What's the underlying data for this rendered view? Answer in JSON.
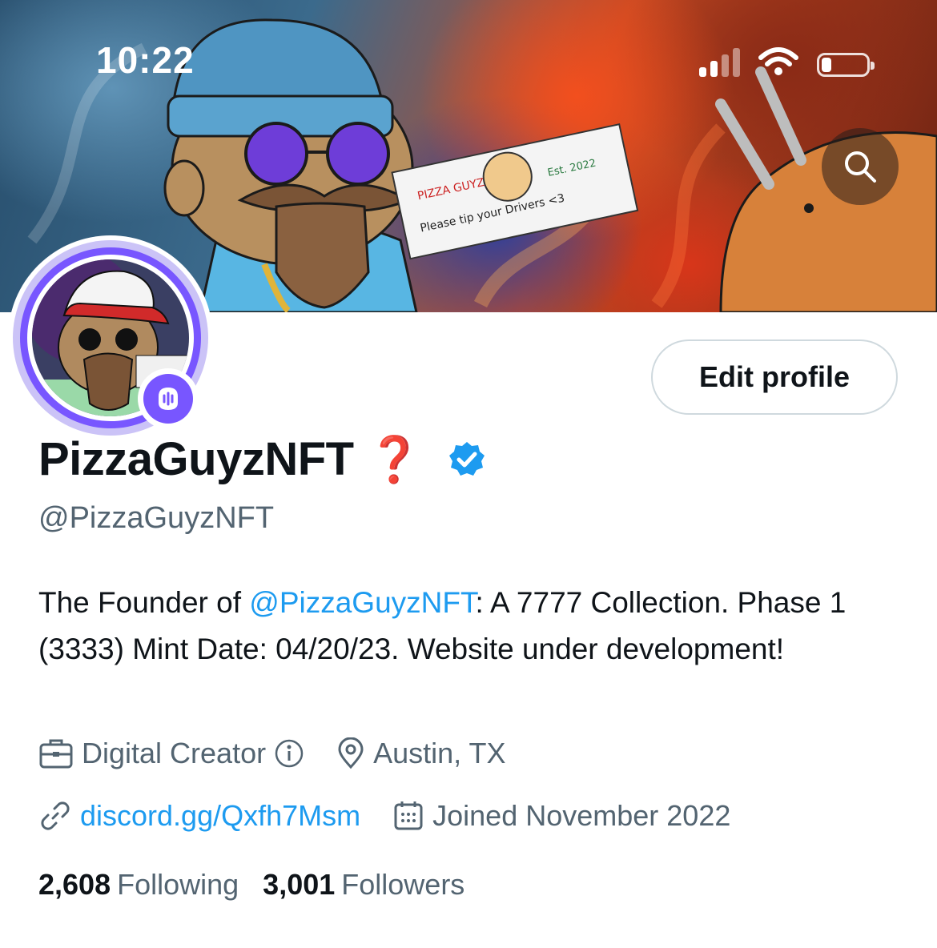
{
  "status_bar": {
    "time": "10:22"
  },
  "profile": {
    "display_name": "PizzaGuyzNFT",
    "name_emoji": "❓",
    "handle": "@PizzaGuyzNFT",
    "edit_label": "Edit profile",
    "bio": {
      "prefix": "The Founder of ",
      "mention": "@PizzaGuyzNFT",
      "suffix": ": A 7777 Collection. Phase 1 (3333) Mint Date: 04/20/23. Website under development!"
    },
    "category": "Digital Creator",
    "location": "Austin, TX",
    "link": "discord.gg/Qxfh7Msm",
    "joined": "Joined November 2022",
    "following_count": "2,608",
    "following_label": "Following",
    "followers_count": "3,001",
    "followers_label": "Followers"
  },
  "colors": {
    "accent": "#1d9bf0",
    "secondary_text": "#536471",
    "spaces_purple": "#7856ff",
    "verified": "#1d9bf0"
  },
  "icons": [
    "search-icon",
    "spaces-icon",
    "verified-icon",
    "briefcase-icon",
    "info-icon",
    "location-pin-icon",
    "link-icon",
    "calendar-icon"
  ]
}
